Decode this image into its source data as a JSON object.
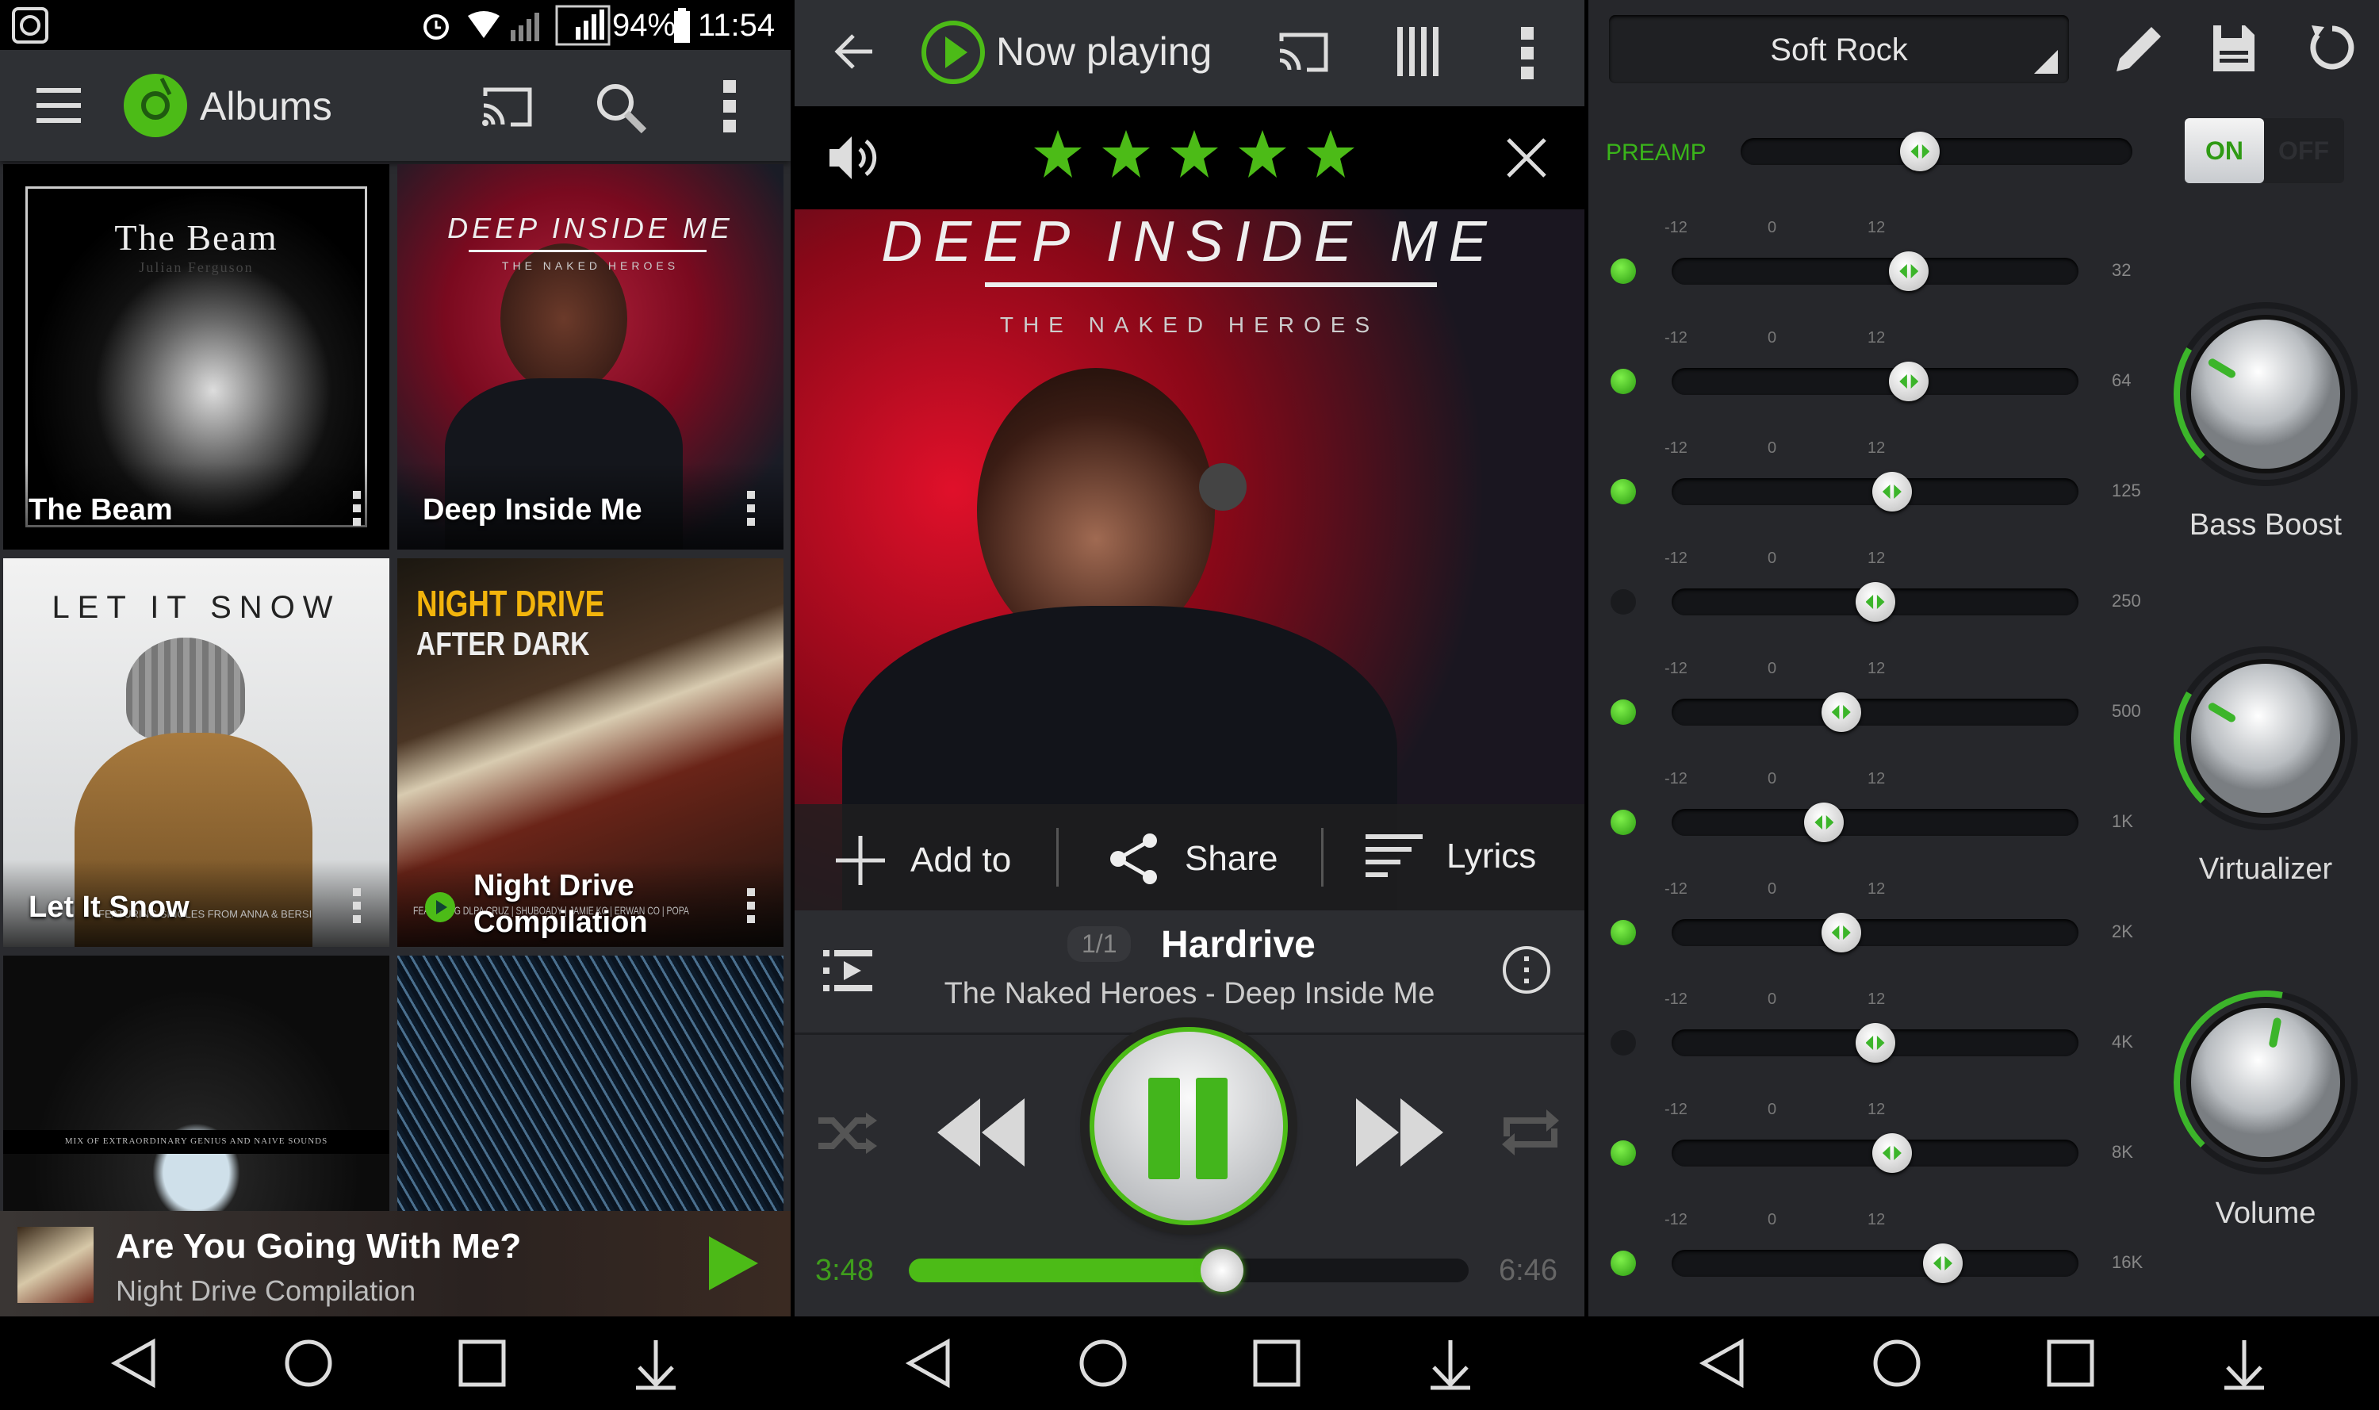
{
  "status_bar": {
    "battery": "94%",
    "time": "11:54",
    "icons": [
      "app-notification-icon",
      "alarm-icon",
      "wifi-icon",
      "signal-sim1-icon",
      "signal-4g-sim2-icon",
      "battery-icon"
    ]
  },
  "albums_screen": {
    "title": "Albums",
    "icons": [
      "menu-icon",
      "app-logo-icon",
      "cast-icon",
      "search-icon",
      "more-vert-icon"
    ],
    "albums": [
      {
        "name": "The Beam",
        "cover_title": "The Beam",
        "cover_subtitle": "Julian Ferguson"
      },
      {
        "name": "Deep Inside Me",
        "cover_title": "DEEP INSIDE ME",
        "cover_subtitle": "THE NAKED HEROES"
      },
      {
        "name": "Let It Snow",
        "cover_title": "LET IT SNOW",
        "cover_subtitle": "FEATURING SINGLES FROM ANNA & BERSI"
      },
      {
        "name": "Night Drive Compilation",
        "cover_title": "NIGHT DRIVE",
        "cover_subtitle": "AFTER DARK",
        "cover_credits": "FEATURING DLPA CRUZ | SHUBOADY | JAMIE KC | ERWAN CO | POPA",
        "playing": true
      },
      {
        "name": "",
        "cover_subtitle": "MIX OF EXTRAORDINARY GENIUS AND NAIVE SOUNDS"
      },
      {
        "name": ""
      }
    ],
    "mini_player": {
      "title": "Are You Going With Me?",
      "subtitle": "Night Drive Compilation"
    }
  },
  "now_playing": {
    "title": "Now playing",
    "rating": 5,
    "rating_max": 5,
    "cover_title": "DEEP INSIDE ME",
    "cover_subtitle": "THE NAKED HEROES",
    "actions": {
      "add_to": "Add to",
      "share": "Share",
      "lyrics": "Lyrics"
    },
    "queue_position": "1/1",
    "track": "Hardrive",
    "artist_album": "The Naked Heroes - Deep Inside Me",
    "elapsed": "3:48",
    "duration": "6:46",
    "progress": 0.56,
    "accent": "#4cbb17"
  },
  "equalizer": {
    "preset": "Soft Rock",
    "preamp_label": "PREAMP",
    "preamp_value": -1,
    "toggle_on": "ON",
    "toggle_off": "OFF",
    "enabled": true,
    "scale": {
      "min": "-12",
      "mid": "0",
      "max": "12"
    },
    "bands": [
      {
        "freq": "32",
        "gain": 2,
        "active": true
      },
      {
        "freq": "64",
        "gain": 2,
        "active": true
      },
      {
        "freq": "125",
        "gain": 1,
        "active": true
      },
      {
        "freq": "250",
        "gain": 0,
        "active": false
      },
      {
        "freq": "500",
        "gain": -2,
        "active": true
      },
      {
        "freq": "1K",
        "gain": -3,
        "active": true
      },
      {
        "freq": "2K",
        "gain": -2,
        "active": true
      },
      {
        "freq": "4K",
        "gain": 0,
        "active": false
      },
      {
        "freq": "8K",
        "gain": 1,
        "active": true
      },
      {
        "freq": "16K",
        "gain": 4,
        "active": true
      }
    ],
    "knobs": [
      {
        "label": "Bass Boost",
        "level": 0.28
      },
      {
        "label": "Virtualizer",
        "level": 0.28
      },
      {
        "label": "Volume",
        "level": 0.54
      }
    ]
  }
}
